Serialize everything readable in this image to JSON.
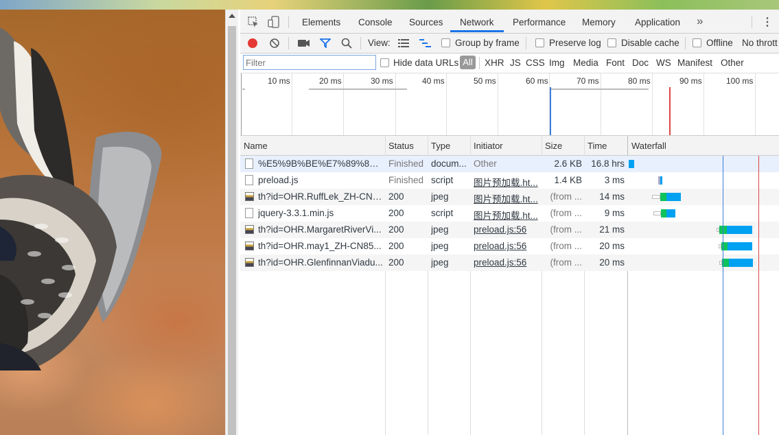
{
  "devtools": {
    "tabs": [
      "Elements",
      "Console",
      "Sources",
      "Network",
      "Performance",
      "Memory",
      "Application"
    ],
    "active_tab": "Network",
    "more_tabs_icon": "double-chevron-right-icon",
    "menu_icon": "vertical-ellipsis-icon"
  },
  "toolbar": {
    "view_label": "View:",
    "group_by_frame": "Group by frame",
    "preserve_log": "Preserve log",
    "disable_cache": "Disable cache",
    "offline": "Offline",
    "throttle": "No thrott"
  },
  "filterbar": {
    "filter_placeholder": "Filter",
    "hide_data_urls": "Hide data URLs",
    "all": "All",
    "types": [
      "XHR",
      "JS",
      "CSS",
      "Img",
      "Media",
      "Font",
      "Doc",
      "WS",
      "Manifest",
      "Other"
    ]
  },
  "overview": {
    "ticks": [
      "10 ms",
      "20 ms",
      "30 ms",
      "40 ms",
      "50 ms",
      "60 ms",
      "70 ms",
      "80 ms",
      "90 ms",
      "100 ms"
    ]
  },
  "columns": [
    "Name",
    "Status",
    "Type",
    "Initiator",
    "Size",
    "Time",
    "Waterfall"
  ],
  "requests": [
    {
      "name": "%E5%9B%BE%E7%89%87%...",
      "status": "Finished",
      "type": "docum...",
      "initiator": "Other",
      "size": "2.6 KB",
      "time": "16.8 hrs",
      "icon": "doc"
    },
    {
      "name": "preload.js",
      "status": "Finished",
      "type": "script",
      "initiator": "图片预加载.ht...",
      "size": "1.4 KB",
      "time": "3 ms",
      "icon": "doc"
    },
    {
      "name": "th?id=OHR.RuffLek_ZH-CN8...",
      "status": "200",
      "type": "jpeg",
      "initiator": "图片预加载.ht...",
      "size": "(from ...",
      "time": "14 ms",
      "icon": "img"
    },
    {
      "name": "jquery-3.3.1.min.js",
      "status": "200",
      "type": "script",
      "initiator": "图片预加载.ht...",
      "size": "(from ...",
      "time": "9 ms",
      "icon": "doc"
    },
    {
      "name": "th?id=OHR.MargaretRiverVi...",
      "status": "200",
      "type": "jpeg",
      "initiator": "preload.js:56",
      "size": "(from ...",
      "time": "21 ms",
      "icon": "img"
    },
    {
      "name": "th?id=OHR.may1_ZH-CN85...",
      "status": "200",
      "type": "jpeg",
      "initiator": "preload.js:56",
      "size": "(from ...",
      "time": "20 ms",
      "icon": "img"
    },
    {
      "name": "th?id=OHR.GlenfinnanViadu...",
      "status": "200",
      "type": "jpeg",
      "initiator": "preload.js:56",
      "size": "(from ...",
      "time": "20 ms",
      "icon": "img"
    }
  ],
  "colors": {
    "record": "#e53935",
    "accent": "#1a73e8",
    "wf_green": "#0fc25a",
    "wf_blue": "#00a1f1",
    "dom_line": "#3b7ddb",
    "load_line": "#d44"
  }
}
